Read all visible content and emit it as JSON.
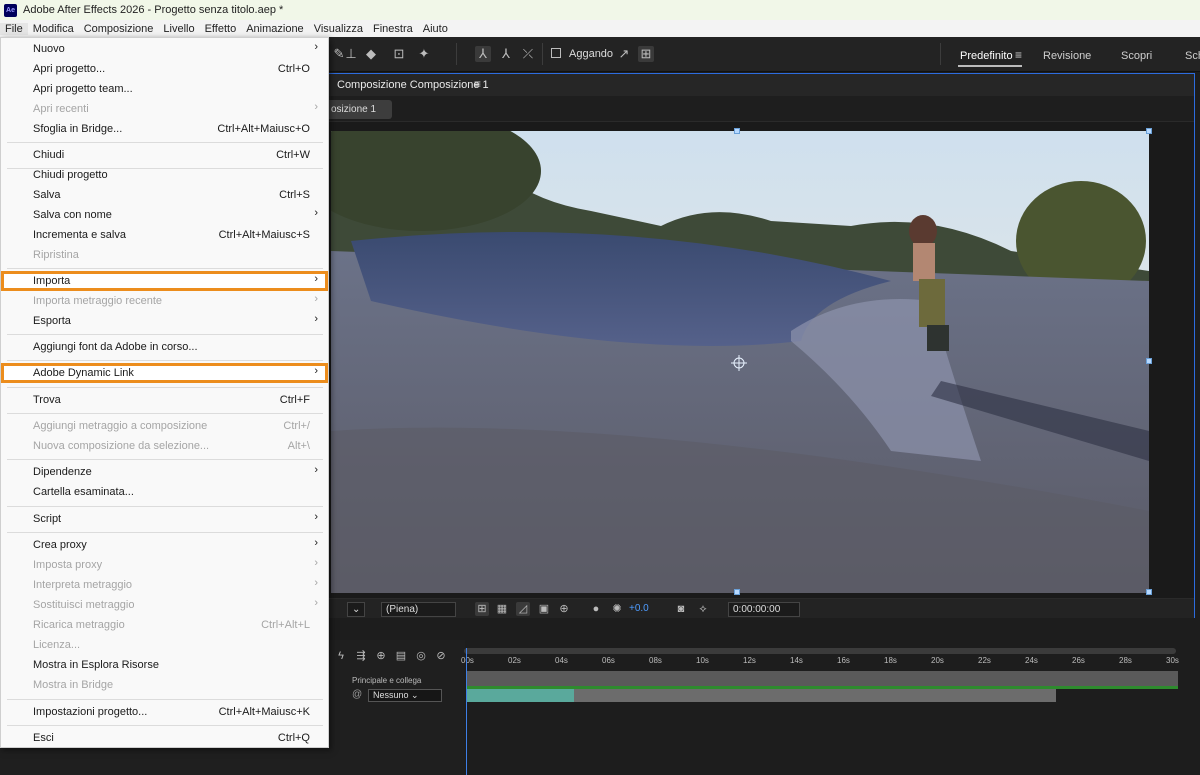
{
  "window": {
    "title": "Adobe After Effects 2026 - Progetto senza titolo.aep *",
    "app_icon_text": "Ae"
  },
  "menubar": [
    "File",
    "Modifica",
    "Composizione",
    "Livello",
    "Effetto",
    "Animazione",
    "Visualizza",
    "Finestra",
    "Aiuto"
  ],
  "toolbar": {
    "snap_label": "Aggando",
    "workspaces": [
      "Predefinito",
      "Revisione",
      "Scopri",
      "Sch"
    ]
  },
  "composition": {
    "panel_title": "Composizione Composizione 1",
    "subtab": "osizione 1",
    "zoom_resolution": "(Piena)",
    "exposure": "+0.0",
    "timecode": "0:00:00:00"
  },
  "timeline": {
    "ticks": [
      "00s",
      "02s",
      "04s",
      "06s",
      "08s",
      "10s",
      "12s",
      "14s",
      "16s",
      "18s",
      "20s",
      "22s",
      "24s",
      "26s",
      "28s",
      "30s"
    ],
    "parent_column_label": "Principale e collega",
    "parent_value": "Nessuno"
  },
  "file_menu": {
    "items": [
      {
        "label": "Nuovo",
        "shortcut": "",
        "submenu": true,
        "disabled": false,
        "highlighted": false
      },
      {
        "label": "Apri progetto...",
        "shortcut": "Ctrl+O",
        "submenu": false,
        "disabled": false,
        "highlighted": false
      },
      {
        "label": "Apri progetto team...",
        "shortcut": "",
        "submenu": false,
        "disabled": false,
        "highlighted": false
      },
      {
        "label": "Apri recenti",
        "shortcut": "",
        "submenu": true,
        "disabled": true,
        "highlighted": false
      },
      {
        "label": "Sfoglia in Bridge...",
        "shortcut": "Ctrl+Alt+Maiusc+O",
        "submenu": false,
        "disabled": false,
        "highlighted": false
      },
      {
        "label": "Chiudi",
        "shortcut": "Ctrl+W",
        "submenu": false,
        "disabled": false,
        "highlighted": false
      },
      {
        "label": "Chiudi progetto",
        "shortcut": "",
        "submenu": false,
        "disabled": false,
        "highlighted": false
      },
      {
        "label": "Salva",
        "shortcut": "Ctrl+S",
        "submenu": false,
        "disabled": false,
        "highlighted": false
      },
      {
        "label": "Salva con nome",
        "shortcut": "",
        "submenu": true,
        "disabled": false,
        "highlighted": false
      },
      {
        "label": "Incrementa e salva",
        "shortcut": "Ctrl+Alt+Maiusc+S",
        "submenu": false,
        "disabled": false,
        "highlighted": false
      },
      {
        "label": "Ripristina",
        "shortcut": "",
        "submenu": false,
        "disabled": true,
        "highlighted": false
      },
      {
        "label": "Importa",
        "shortcut": "",
        "submenu": true,
        "disabled": false,
        "highlighted": true
      },
      {
        "label": "Importa metraggio recente",
        "shortcut": "",
        "submenu": true,
        "disabled": true,
        "highlighted": false
      },
      {
        "label": "Esporta",
        "shortcut": "",
        "submenu": true,
        "disabled": false,
        "highlighted": false
      },
      {
        "label": "Aggiungi font da Adobe in corso...",
        "shortcut": "",
        "submenu": false,
        "disabled": false,
        "highlighted": false
      },
      {
        "label": "Adobe Dynamic Link",
        "shortcut": "",
        "submenu": true,
        "disabled": false,
        "highlighted": true
      },
      {
        "label": "Trova",
        "shortcut": "Ctrl+F",
        "submenu": false,
        "disabled": false,
        "highlighted": false
      },
      {
        "label": "Aggiungi metraggio a composizione",
        "shortcut": "Ctrl+/",
        "submenu": false,
        "disabled": true,
        "highlighted": false
      },
      {
        "label": "Nuova composizione da selezione...",
        "shortcut": "Alt+\\",
        "submenu": false,
        "disabled": true,
        "highlighted": false
      },
      {
        "label": "Dipendenze",
        "shortcut": "",
        "submenu": true,
        "disabled": false,
        "highlighted": false
      },
      {
        "label": "Cartella esaminata...",
        "shortcut": "",
        "submenu": false,
        "disabled": false,
        "highlighted": false
      },
      {
        "label": "Script",
        "shortcut": "",
        "submenu": true,
        "disabled": false,
        "highlighted": false
      },
      {
        "label": "Crea proxy",
        "shortcut": "",
        "submenu": true,
        "disabled": false,
        "highlighted": false
      },
      {
        "label": "Imposta proxy",
        "shortcut": "",
        "submenu": true,
        "disabled": true,
        "highlighted": false
      },
      {
        "label": "Interpreta metraggio",
        "shortcut": "",
        "submenu": true,
        "disabled": true,
        "highlighted": false
      },
      {
        "label": "Sostituisci metraggio",
        "shortcut": "",
        "submenu": true,
        "disabled": true,
        "highlighted": false
      },
      {
        "label": "Ricarica metraggio",
        "shortcut": "Ctrl+Alt+L",
        "submenu": false,
        "disabled": true,
        "highlighted": false
      },
      {
        "label": "Licenza...",
        "shortcut": "",
        "submenu": false,
        "disabled": true,
        "highlighted": false
      },
      {
        "label": "Mostra in Esplora Risorse",
        "shortcut": "",
        "submenu": false,
        "disabled": false,
        "highlighted": false
      },
      {
        "label": "Mostra in Bridge",
        "shortcut": "",
        "submenu": false,
        "disabled": true,
        "highlighted": false
      },
      {
        "label": "Impostazioni progetto...",
        "shortcut": "Ctrl+Alt+Maiusc+K",
        "submenu": false,
        "disabled": false,
        "highlighted": false
      },
      {
        "label": "Esci",
        "shortcut": "Ctrl+Q",
        "submenu": false,
        "disabled": false,
        "highlighted": false
      }
    ]
  },
  "colors": {
    "highlight_outline": "#ec8d1d",
    "accent_blue": "#2d6cdf"
  }
}
